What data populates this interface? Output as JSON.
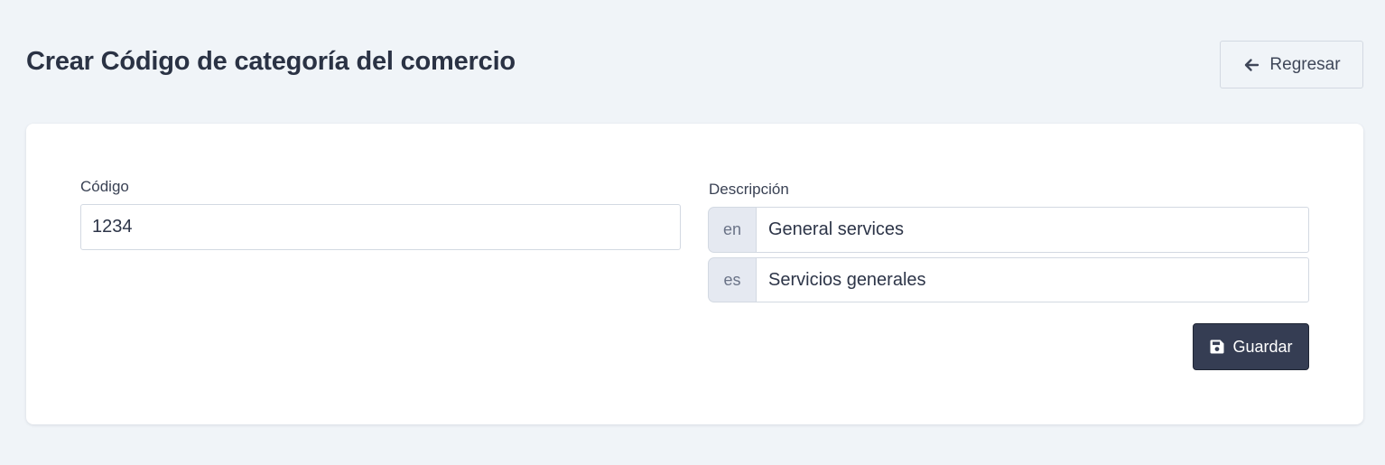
{
  "header": {
    "title": "Crear Código de categoría del comercio",
    "back_label": "Regresar",
    "back_icon": "arrow-left-icon"
  },
  "form": {
    "code": {
      "label": "Código",
      "value": "1234"
    },
    "description": {
      "label": "Descripción",
      "translations": [
        {
          "lang": "en",
          "value": "General services"
        },
        {
          "lang": "es",
          "value": "Servicios generales"
        }
      ]
    },
    "save_label": "Guardar",
    "save_icon": "floppy-disk-icon"
  },
  "colors": {
    "page_background": "#f0f4f8",
    "card_background": "#ffffff",
    "primary_button": "#353d53",
    "addon_background": "#e5e9f1",
    "title_text": "#2a3244"
  }
}
